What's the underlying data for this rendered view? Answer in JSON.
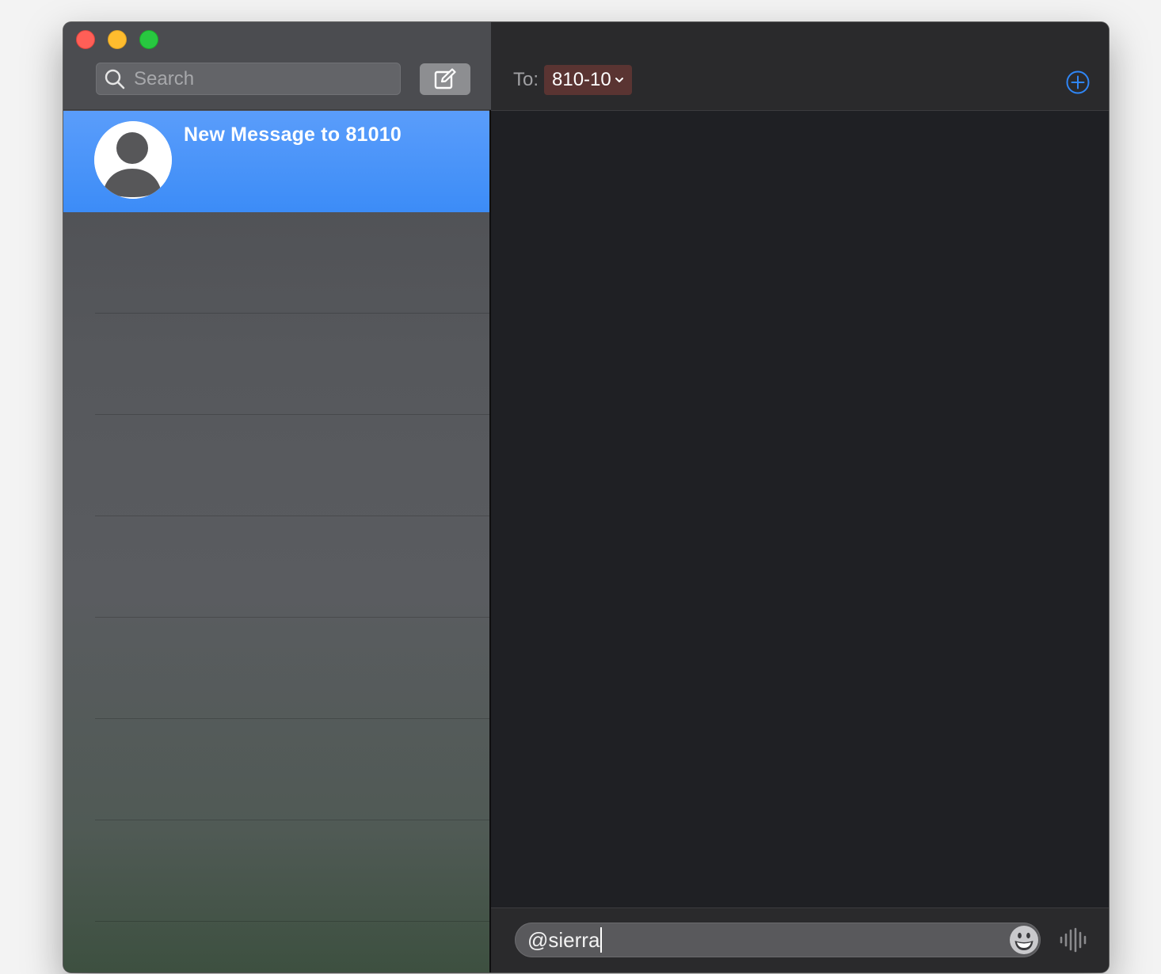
{
  "sidebar": {
    "search": {
      "placeholder": "Search",
      "value": ""
    },
    "compose_icon": "compose-icon",
    "conversations": [
      {
        "title": "New Message to 81010",
        "avatar": "person-icon",
        "selected": true
      }
    ]
  },
  "header": {
    "to_label": "To:",
    "recipient": "810-10",
    "recipient_color": "#5a3432",
    "add_icon": "plus-circle-icon",
    "accent_color": "#2f86f6"
  },
  "composer": {
    "text": "@sierra",
    "emoji_icon": "smiley-icon",
    "audio_icon": "audio-waveform-icon"
  },
  "colors": {
    "selection": "#3c8cf7",
    "close": "#ff5f57",
    "minimize": "#febc2e",
    "maximize": "#28c840"
  }
}
